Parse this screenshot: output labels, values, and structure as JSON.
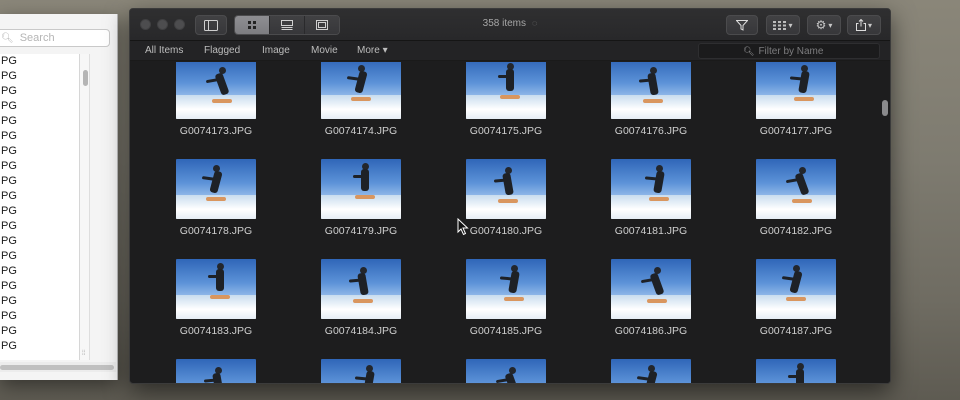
{
  "left_window": {
    "search_placeholder": "Search",
    "files": [
      "PG",
      "PG",
      "PG",
      "PG",
      "PG",
      "PG",
      "PG",
      "PG",
      "PG",
      "PG",
      "PG",
      "PG",
      "PG",
      "PG",
      "PG",
      "PG",
      "PG",
      "PG",
      "PG",
      "PG"
    ],
    "column_marker": "⦙⦙"
  },
  "main_window": {
    "item_count": "358 items",
    "filter_tabs": [
      "All Items",
      "Flagged",
      "Image",
      "Movie",
      "More"
    ],
    "more_chevron": "▾",
    "filter_placeholder": "Filter by Name",
    "view_modes": [
      "grid-view",
      "list-view",
      "single-view"
    ],
    "active_view": "grid-view",
    "toolbar_icons": [
      "sidebar-toggle-icon",
      "filter-icon",
      "thumbnail-size-icon",
      "gear-icon",
      "share-icon"
    ],
    "photos": [
      "G0074173.JPG",
      "G0074174.JPG",
      "G0074175.JPG",
      "G0074176.JPG",
      "G0074177.JPG",
      "G0074178.JPG",
      "G0074179.JPG",
      "G0074180.JPG",
      "G0074181.JPG",
      "G0074182.JPG",
      "G0074183.JPG",
      "G0074184.JPG",
      "G0074185.JPG",
      "G0074186.JPG",
      "G0074187.JPG",
      "",
      "",
      "",
      "",
      ""
    ]
  }
}
